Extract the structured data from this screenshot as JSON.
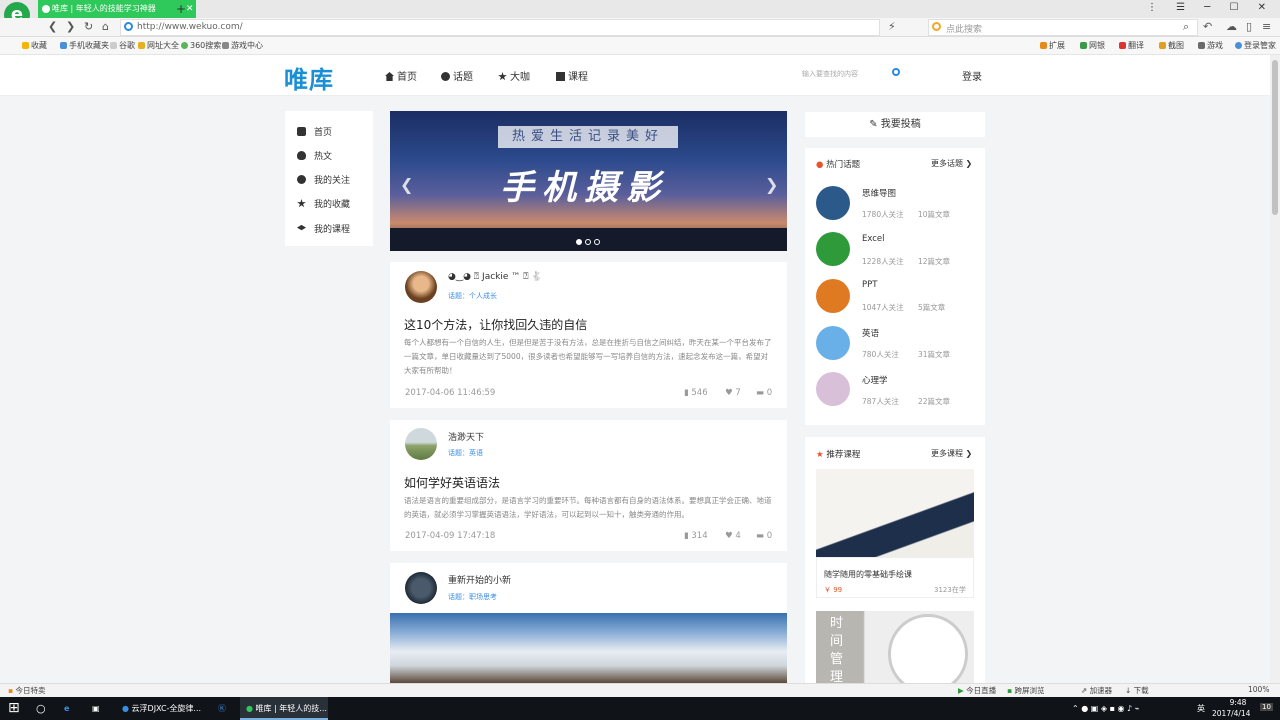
{
  "browser": {
    "tab_title": "唯库 | 年轻人的技能学习神器",
    "new_tab": "+",
    "url": "http://www.wekuo.com/",
    "search_placeholder": "点此搜索",
    "win_ctrls": "⋮ ☰ ─ ☐ ✕",
    "bookmarks": [
      "收藏",
      "手机收藏夹",
      "谷歌",
      "网址大全",
      "360搜索",
      "游戏中心"
    ],
    "right_tools": [
      "扩展",
      "网银",
      "翻译",
      "截图",
      "游戏",
      "登录管家"
    ]
  },
  "site": {
    "logo": "唯库",
    "nav": [
      "首页",
      "话题",
      "大咖",
      "课程"
    ],
    "search_placeholder": "输入要查找的内容",
    "login": "登录"
  },
  "side_menu": [
    "首页",
    "热文",
    "我的关注",
    "我的收藏",
    "我的课程"
  ],
  "banner": {
    "subtitle": "热爱生活记录美好",
    "title": "手机摄影"
  },
  "articles": [
    {
      "author": "◕‿◕ ⍰ Jackie ™ ⍰ 🐇",
      "topic": "话题：个人成长",
      "title": "这10个方法，让你找回久违的自信",
      "excerpt": "每个人都想有一个自信的人生，但是但是苦于没有方法，总是在挫折与自信之间纠结，昨天在某一个平台发布了一篇文章，单日收藏量达到了5000，很多读者也希望能够写一写培养自信的方法，速起念发布这一篇，希望对大家有所帮助！",
      "date": "2017-04-06 11:46:59",
      "likes": "546",
      "hearts": "7",
      "comments": "0"
    },
    {
      "author": "浩渺天下",
      "topic": "话题：英语",
      "title": "如何学好英语语法",
      "excerpt": "语法是语言的重要组成部分，是语言学习的重要环节。每种语言都有自身的语法体系。要想真正学会正确、地道的英语，就必须学习掌握英语语法，学好语法，可以起到以一知十，触类旁通的作用。",
      "date": "2017-04-09 17:47:18",
      "likes": "314",
      "hearts": "4",
      "comments": "0"
    },
    {
      "author": "重新开始的小新",
      "topic": "话题：职场思考"
    }
  ],
  "right": {
    "submit": "我要投稿",
    "hot_topics_title": "热门话题",
    "more_topics": "更多话题",
    "topics": [
      {
        "name": "思维导图",
        "followers": "1780人关注",
        "articles": "10篇文章",
        "color": "#2b5a8a"
      },
      {
        "name": "Excel",
        "followers": "1228人关注",
        "articles": "12篇文章",
        "color": "#2e9a3a"
      },
      {
        "name": "PPT",
        "followers": "1047人关注",
        "articles": "5篇文章",
        "color": "#e07a22"
      },
      {
        "name": "英语",
        "followers": "780人关注",
        "articles": "31篇文章",
        "color": "#6ab0e8"
      },
      {
        "name": "心理学",
        "followers": "787人关注",
        "articles": "22篇文章",
        "color": "#d8c0d8"
      }
    ],
    "courses_title": "推荐课程",
    "more_courses": "更多课程",
    "courses": [
      {
        "title": "随学随用的零基础手绘课",
        "price": "￥ 99",
        "count": "3123在学"
      },
      {
        "title": "时间管理"
      }
    ]
  },
  "statusbar": {
    "left": "今日特卖",
    "items": [
      "今日直播",
      "跨屏浏览",
      "加速器",
      "下载"
    ],
    "zoom": "100%"
  },
  "taskbar": {
    "tasks": [
      "云浮DJXC-全旋律...",
      "唯库 | 年轻人的技..."
    ],
    "time": "9:48",
    "date": "2017/4/14",
    "lang": "英",
    "notif": "10"
  }
}
